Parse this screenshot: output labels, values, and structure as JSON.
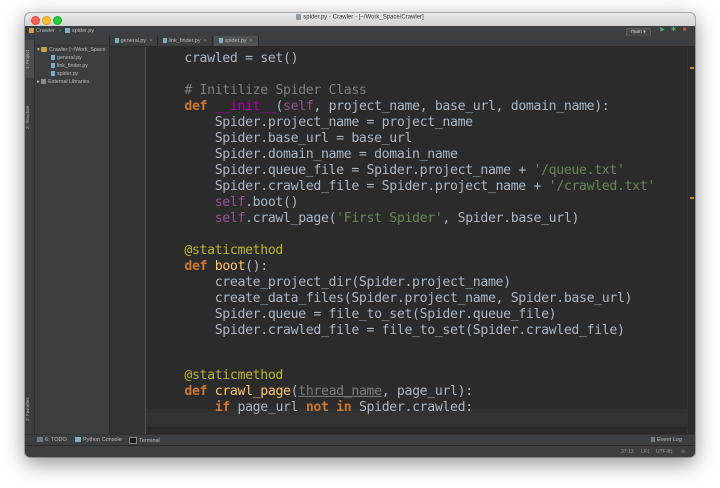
{
  "window": {
    "title": "spider.py - Crawler - [~/Work_Space/Crawler]"
  },
  "navbar": {
    "breadcrumb": [
      "Crawler",
      "spider.py"
    ],
    "run_config": "main",
    "run_config_arrow": "▾",
    "run_icon": "▶",
    "debug_icon": "✱",
    "stop_icon": "■"
  },
  "left_tools": {
    "project_tab": "1: Project",
    "structure_tab": "Z: Structure",
    "favorites_tab": "2: Favorites"
  },
  "project_tree": {
    "root": "Crawler (~/Work_Space",
    "files": [
      "general.py",
      "link_finder.py",
      "spider.py"
    ],
    "external": "External Libraries"
  },
  "tabs": [
    {
      "label": "general.py",
      "active": false
    },
    {
      "label": "link_finder.py",
      "active": false
    },
    {
      "label": "spider.py",
      "active": true
    }
  ],
  "tab_close_glyph": "×",
  "code": {
    "l01": {
      "a": "    crawled = set()"
    },
    "l02": {
      "a": ""
    },
    "l03": {
      "a": "    # Initilize Spider Class"
    },
    "l04": {
      "a": "    ",
      "b": "def",
      "c": " ",
      "d": "__init__",
      "e": "(",
      "f": "self",
      "g": ", project_name, base_url, domain_name):"
    },
    "l05": {
      "a": "        Spider.project_name = project_name"
    },
    "l06": {
      "a": "        Spider.base_url = base_url"
    },
    "l07": {
      "a": "        Spider.domain_name = domain_name"
    },
    "l08": {
      "a": "        Spider.queue_file = Spider.project_name + ",
      "b": "'/queue.txt'"
    },
    "l09": {
      "a": "        Spider.crawled_file = Spider.project_name + ",
      "b": "'/crawled.txt'"
    },
    "l10": {
      "a": "        ",
      "b": "self",
      "c": ".boot()"
    },
    "l11": {
      "a": "        ",
      "b": "self",
      "c": ".crawl_page(",
      "d": "'First Spider'",
      "e": ", Spider.base_url)"
    },
    "l12": {
      "a": ""
    },
    "l13": {
      "a": "    ",
      "b": "@staticmethod"
    },
    "l14": {
      "a": "    ",
      "b": "def",
      "c": " ",
      "d": "boot",
      "e": "():"
    },
    "l15": {
      "a": "        create_project_dir(Spider.project_name)"
    },
    "l16": {
      "a": "        create_data_files(Spider.project_name, Spider.base_url)"
    },
    "l17": {
      "a": "        Spider.queue = file_to_set(Spider.queue_file)"
    },
    "l18": {
      "a": "        Spider.crawled_file = file_to_set(Spider.crawled_file)"
    },
    "l19": {
      "a": ""
    },
    "l20": {
      "a": ""
    },
    "l21": {
      "a": "    ",
      "b": "@staticmethod"
    },
    "l22": {
      "a": "    ",
      "b": "def",
      "c": " ",
      "d": "crawl_page",
      "e": "(",
      "f": "thread_name",
      "g": ", page_url):"
    },
    "l23": {
      "a": "        ",
      "b": "if",
      "c": " page_url ",
      "d": "not in",
      "e": " Spider.crawled:"
    }
  },
  "bottom_tools": {
    "todo": "6: TODO",
    "python_console": "Python Console",
    "terminal": "Terminal",
    "event_log": "Event Log"
  },
  "status": {
    "position": "37:13",
    "line_sep": "LF‡",
    "encoding": "UTF-8‡"
  },
  "colors": {
    "editor_bg": "#2b2b2b",
    "keyword": "#cc7832",
    "function": "#ffc66d",
    "string": "#6a8759",
    "comment": "#808080",
    "decorator": "#bbb529",
    "self": "#94558d",
    "dunder": "#b200b2"
  }
}
